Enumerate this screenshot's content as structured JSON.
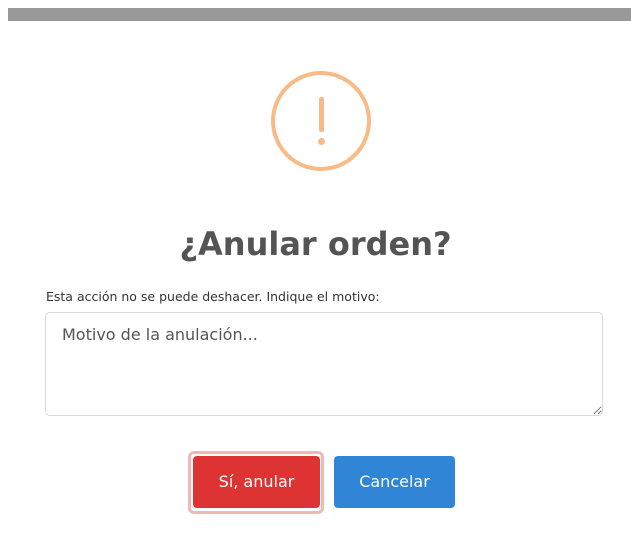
{
  "dialog": {
    "icon": "warning-icon",
    "title": "¿Anular orden?",
    "reason_label": "Esta acción no se puede deshacer. Indique el motivo:",
    "reason_placeholder": "Motivo de la anulación...",
    "reason_value": "",
    "confirm_label": "Sí, anular",
    "cancel_label": "Cancelar"
  },
  "colors": {
    "warning": "#f8bb86",
    "confirm": "#dd3333",
    "cancel": "#3085d6",
    "title": "#545454",
    "top_bar": "#999999"
  }
}
